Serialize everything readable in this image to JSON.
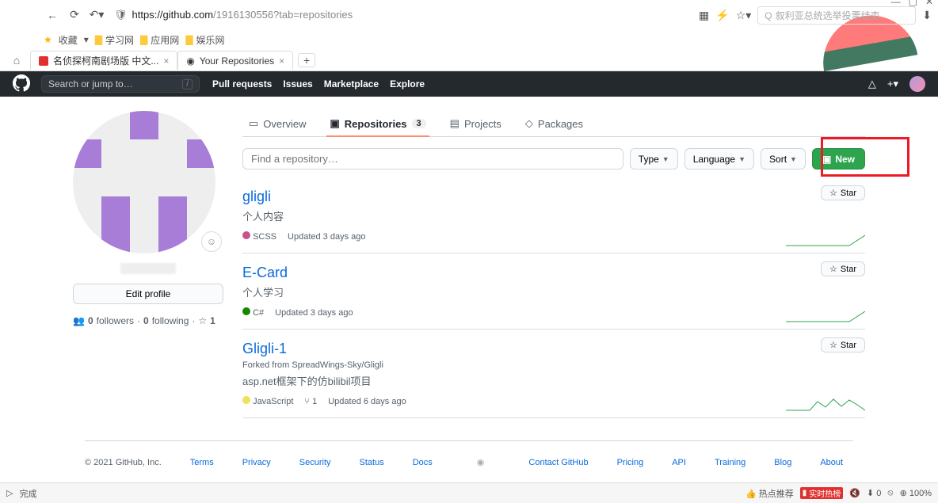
{
  "browser": {
    "url_scheme": "https",
    "url_host": "://github.com",
    "url_path": "/1916130556?tab=repositories",
    "search_placeholder": "叙利亚总统选举投票结束",
    "bookmarks_label": "收藏",
    "folders": [
      "学习网",
      "应用网",
      "娱乐网"
    ],
    "tabs": [
      {
        "title": "名侦探柯南剧场版 中文..."
      },
      {
        "title": "Your Repositories"
      }
    ],
    "status_done": "完成",
    "taskbar": {
      "hot": "热点推荐",
      "hotlist": "实时热榜",
      "zoom": "100%",
      "download": "0"
    }
  },
  "github": {
    "search_placeholder": "Search or jump to…",
    "nav": [
      "Pull requests",
      "Issues",
      "Marketplace",
      "Explore"
    ],
    "tabs": {
      "overview": "Overview",
      "repositories": "Repositories",
      "repo_count": "3",
      "projects": "Projects",
      "packages": "Packages"
    },
    "sidebar": {
      "edit_profile": "Edit profile",
      "followers_count": "0",
      "followers_label": "followers",
      "following_count": "0",
      "following_label": "following",
      "stars": "1"
    },
    "filter": {
      "find_placeholder": "Find a repository…",
      "type": "Type",
      "language": "Language",
      "sort": "Sort",
      "new": "New"
    },
    "star_label": "Star",
    "repos": [
      {
        "name": "gligli",
        "desc": "个人内容",
        "lang": "SCSS",
        "lang_color": "#c6538c",
        "updated": "Updated 3 days ago"
      },
      {
        "name": "E-Card",
        "desc": "个人学习",
        "lang": "C#",
        "lang_color": "#178600",
        "updated": "Updated 3 days ago"
      },
      {
        "name": "Gligli-1",
        "forked_from_prefix": "Forked from ",
        "forked_from": "SpreadWings-Sky/Gligli",
        "desc": "asp.net框架下的仿bilibil项目",
        "lang": "JavaScript",
        "lang_color": "#f1e05a",
        "forks": "1",
        "updated": "Updated 6 days ago"
      }
    ],
    "footer": {
      "copyright": "© 2021 GitHub, Inc.",
      "links": [
        "Terms",
        "Privacy",
        "Security",
        "Status",
        "Docs",
        "Contact GitHub",
        "Pricing",
        "API",
        "Training",
        "Blog",
        "About"
      ]
    }
  }
}
